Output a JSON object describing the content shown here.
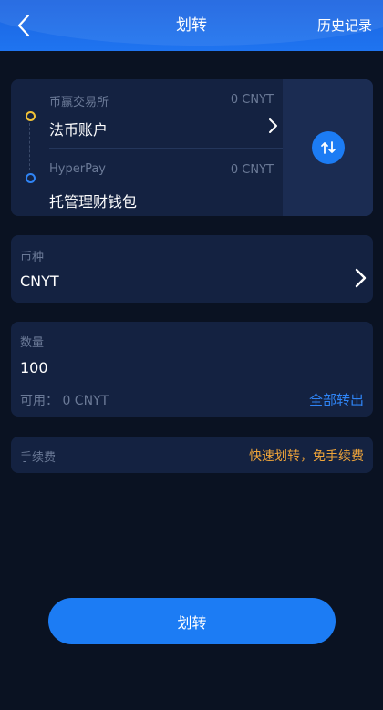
{
  "header": {
    "title": "划转",
    "history_label": "历史记录",
    "background_color": "#1f74f0"
  },
  "transfer": {
    "from": {
      "exchange": "币赢交易所",
      "balance": "0 CNYT",
      "account": "法币账户"
    },
    "to": {
      "exchange": "HyperPay",
      "balance": "0 CNYT",
      "account": "托管理财钱包"
    },
    "swap_icon": "swap-arrows-icon"
  },
  "currency": {
    "label": "币种",
    "value": "CNYT"
  },
  "amount": {
    "label": "数量",
    "value": "100",
    "available": "可用： 0 CNYT",
    "transfer_all_label": "全部转出"
  },
  "fee": {
    "label": "手续费",
    "note": "快速划转，免手续费"
  },
  "submit_label": "划转",
  "colors": {
    "accent": "#1c7cf4",
    "link": "#2f84f5",
    "warning": "#f0a53a",
    "from_dot": "#f2c237",
    "page_background": "#0a1222",
    "card_background": "#142241"
  }
}
